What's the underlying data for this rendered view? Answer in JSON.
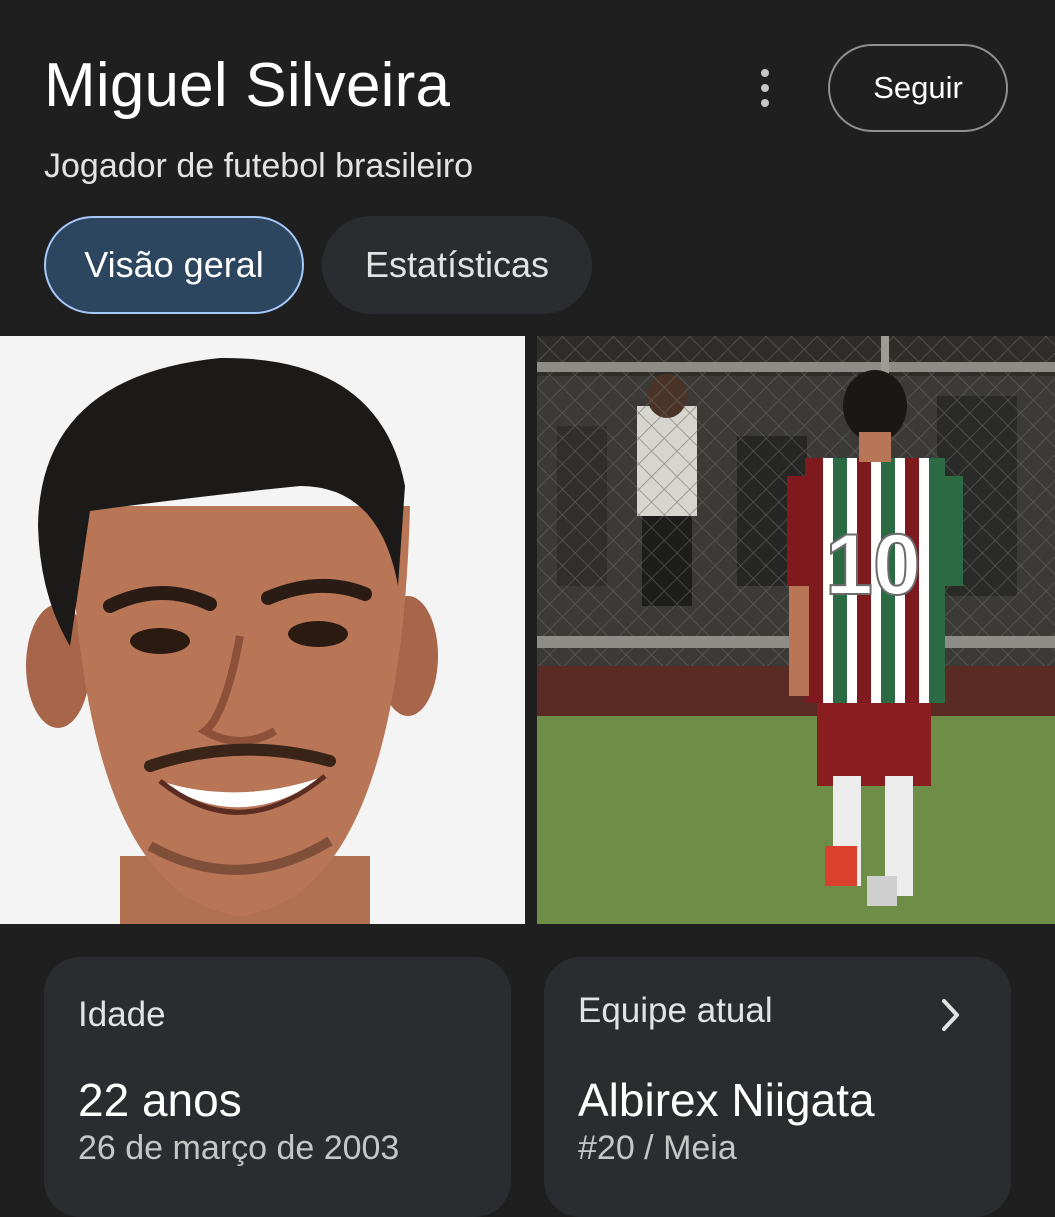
{
  "header": {
    "title": "Miguel Silveira",
    "subtitle": "Jogador de futebol brasileiro",
    "follow_label": "Seguir",
    "more_icon": "more-vert-icon"
  },
  "tabs": [
    {
      "label": "Visão geral",
      "selected": true
    },
    {
      "label": "Estatísticas",
      "selected": false
    }
  ],
  "photos": [
    {
      "subject": "headshot"
    },
    {
      "subject": "player in jersey number",
      "jersey_number": "10"
    }
  ],
  "cards": {
    "age": {
      "label": "Idade",
      "value": "22 anos",
      "sub": "26 de março de 2003"
    },
    "team": {
      "label": "Equipe atual",
      "value": "Albirex Niigata",
      "sub": "#20 / Meia",
      "icon": "chevron-right-icon"
    }
  },
  "colors": {
    "background": "#1f1f1f",
    "tab_selected_bg": "#2c4660",
    "tab_selected_border": "#a8c7fa",
    "card_bg": "#2b2c30"
  }
}
